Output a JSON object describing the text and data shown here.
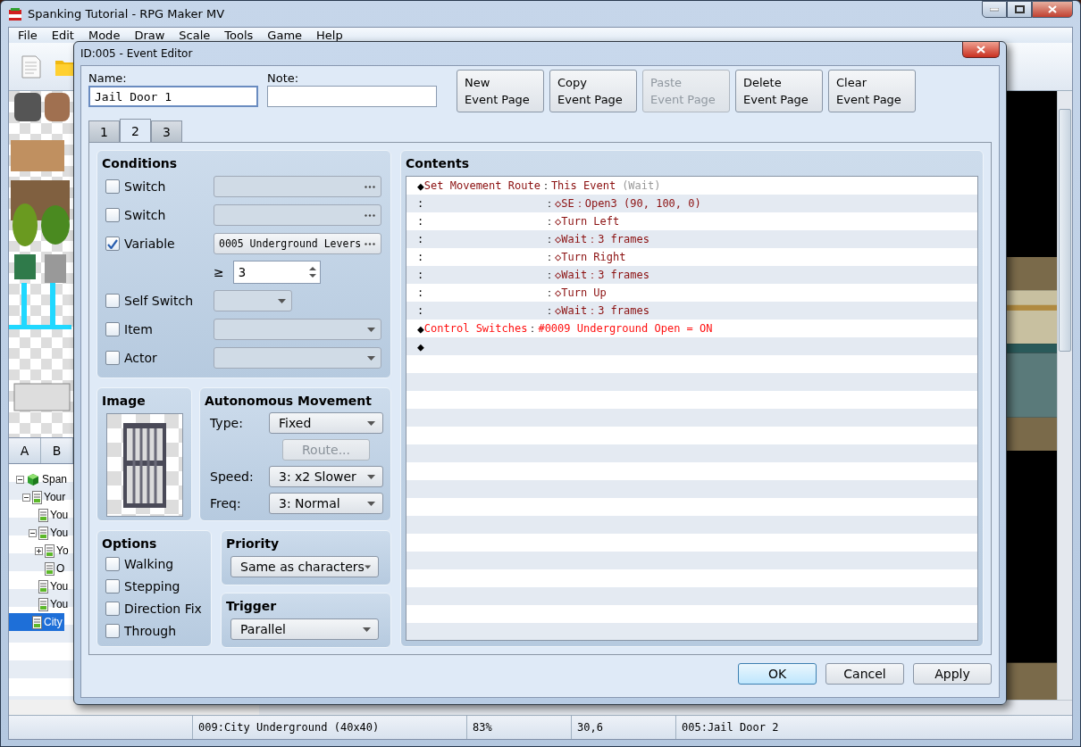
{
  "window": {
    "title": "Spanking Tutorial - RPG Maker MV"
  },
  "menu": [
    "File",
    "Edit",
    "Mode",
    "Draw",
    "Scale",
    "Tools",
    "Game",
    "Help"
  ],
  "palette_tabs": [
    "A",
    "B"
  ],
  "map_tree": [
    {
      "label": "Span",
      "kind": "project",
      "expanded": true,
      "selected": false,
      "children": [
        {
          "label": "Your",
          "kind": "map",
          "expanded": true,
          "selected": false,
          "children": [
            {
              "label": "You",
              "kind": "map",
              "selected": false
            },
            {
              "label": "You",
              "kind": "map",
              "expanded": true,
              "selected": false,
              "children": [
                {
                  "label": "Yo",
                  "kind": "map",
                  "expanded": false,
                  "selected": false
                },
                {
                  "label": "O",
                  "kind": "map",
                  "selected": false
                }
              ]
            },
            {
              "label": "You",
              "kind": "map",
              "selected": false
            },
            {
              "label": "You",
              "kind": "map",
              "selected": false
            }
          ]
        },
        {
          "label": "City",
          "kind": "map",
          "selected": true
        }
      ]
    }
  ],
  "status_bar": [
    "009:City Underground (40x40)",
    "83%",
    "30,6",
    "005:Jail Door 2"
  ],
  "dialog": {
    "title": "ID:005 - Event Editor",
    "name": {
      "label": "Name:",
      "value": "Jail Door 1"
    },
    "note": {
      "label": "Note:"
    },
    "page_buttons": [
      {
        "lines": [
          "New",
          "Event Page"
        ],
        "disabled": false
      },
      {
        "lines": [
          "Copy",
          "Event Page"
        ],
        "disabled": false
      },
      {
        "lines": [
          "Paste",
          "Event Page"
        ],
        "disabled": true
      },
      {
        "lines": [
          "Delete",
          "Event Page"
        ],
        "disabled": false
      },
      {
        "lines": [
          "Clear",
          "Event Page"
        ],
        "disabled": false
      }
    ],
    "page_tabs": [
      {
        "label": "1",
        "selected": false
      },
      {
        "label": "2",
        "selected": true
      },
      {
        "label": "3",
        "selected": false
      }
    ],
    "conditions": {
      "title": "Conditions",
      "rows": [
        {
          "kind": "check",
          "label": "Switch",
          "checked": false,
          "control": {
            "kind": "picker"
          }
        },
        {
          "kind": "check",
          "label": "Switch",
          "checked": false,
          "control": {
            "kind": "picker"
          }
        },
        {
          "kind": "check",
          "label": "Variable",
          "checked": true,
          "control": {
            "kind": "picker",
            "value": "0005 Underground Levers"
          }
        },
        {
          "kind": "compare",
          "operator": "≥",
          "value": "3"
        },
        {
          "kind": "check",
          "label": "Self Switch",
          "checked": false,
          "control": {
            "kind": "short-dropdown"
          }
        },
        {
          "kind": "check",
          "label": "Item",
          "checked": false,
          "control": {
            "kind": "dropdown"
          }
        },
        {
          "kind": "check",
          "label": "Actor",
          "checked": false,
          "control": {
            "kind": "dropdown"
          }
        }
      ]
    },
    "image": {
      "title": "Image"
    },
    "movement": {
      "title": "Autonomous Movement",
      "rows": [
        {
          "kind": "dropdown",
          "label": "Type:",
          "value": "Fixed"
        },
        {
          "kind": "button",
          "value": "Route...",
          "disabled": true
        },
        {
          "kind": "dropdown",
          "label": "Speed:",
          "value": "3: x2 Slower"
        },
        {
          "kind": "dropdown",
          "label": "Freq:",
          "value": "3: Normal"
        }
      ]
    },
    "options": {
      "title": "Options",
      "items": [
        {
          "label": "Walking",
          "checked": false
        },
        {
          "label": "Stepping",
          "checked": false
        },
        {
          "label": "Direction Fix",
          "checked": false
        },
        {
          "label": "Through",
          "checked": false
        }
      ]
    },
    "priority": {
      "title": "Priority",
      "value": "Same as characters"
    },
    "trigger": {
      "title": "Trigger",
      "value": "Parallel"
    },
    "contents": {
      "title": "Contents",
      "rows": [
        {
          "kind": "command",
          "marker": "◆",
          "label": "Set Movement Route",
          "separator": "：",
          "value": "This Event",
          "suffix": "(Wait)",
          "color": "#8b1010"
        },
        {
          "kind": "sub",
          "lead": ":",
          "separator": "：",
          "marker": "◇",
          "value": "SE：Open3 (90, 100, 0)",
          "color": "#8b1010"
        },
        {
          "kind": "sub",
          "lead": ":",
          "separator": "：",
          "marker": "◇",
          "value": "Turn Left",
          "color": "#8b1010"
        },
        {
          "kind": "sub",
          "lead": ":",
          "separator": "：",
          "marker": "◇",
          "value": "Wait：3 frames",
          "color": "#8b1010"
        },
        {
          "kind": "sub",
          "lead": ":",
          "separator": "：",
          "marker": "◇",
          "value": "Turn Right",
          "color": "#8b1010"
        },
        {
          "kind": "sub",
          "lead": ":",
          "separator": "：",
          "marker": "◇",
          "value": "Wait：3 frames",
          "color": "#8b1010"
        },
        {
          "kind": "sub",
          "lead": ":",
          "separator": "：",
          "marker": "◇",
          "value": "Turn Up",
          "color": "#8b1010"
        },
        {
          "kind": "sub",
          "lead": ":",
          "separator": "：",
          "marker": "◇",
          "value": "Wait：3 frames",
          "color": "#8b1010"
        },
        {
          "kind": "command",
          "marker": "◆",
          "label": "Control Switches",
          "separator": "：",
          "value": "#0009 Underground Open = ON",
          "color": "#ff1010"
        },
        {
          "kind": "end",
          "marker": "◆"
        }
      ]
    },
    "buttons": [
      {
        "label": "OK",
        "default": true
      },
      {
        "label": "Cancel",
        "default": false
      },
      {
        "label": "Apply",
        "default": false
      }
    ]
  }
}
